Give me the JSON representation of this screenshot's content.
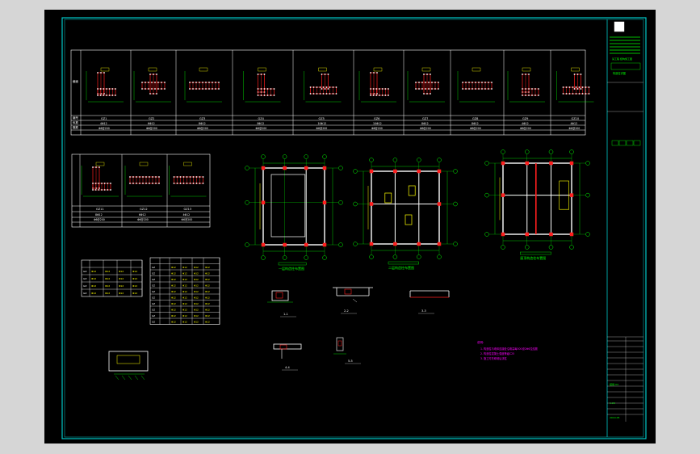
{
  "drawing": {
    "sheet_name": "CAD structural drawing sheet",
    "colors": {
      "background": "#000000",
      "frame": "#00c8c8",
      "lines": "#ffffff",
      "rebar": "#ff1e1e",
      "dims": "#00ff00",
      "text_yellow": "#ffff00",
      "notes": "#ff00ff"
    },
    "title_block": {
      "project": "某工程 结构施工图",
      "drawing_title": "构造柱详图",
      "drawing_no": "结施-04",
      "scale": "1:20",
      "date": "2010.05"
    },
    "column_table_top": {
      "row_labels": [
        "截面",
        "编号",
        "纵筋",
        "箍筋"
      ],
      "columns": [
        {
          "id": "GZ1",
          "bars": "4Φ12",
          "stirrup": "Φ6@200"
        },
        {
          "id": "GZ2",
          "bars": "6Φ12",
          "stirrup": "Φ6@200"
        },
        {
          "id": "GZ3",
          "bars": "8Φ12",
          "stirrup": "Φ6@200"
        },
        {
          "id": "GZ4",
          "bars": "8Φ12",
          "stirrup": "Φ6@200"
        },
        {
          "id": "GZ5",
          "bars": "10Φ12",
          "stirrup": "Φ6@200"
        },
        {
          "id": "GZ6",
          "bars": "10Φ12",
          "stirrup": "Φ6@200"
        },
        {
          "id": "GZ7",
          "bars": "8Φ12",
          "stirrup": "Φ6@200"
        },
        {
          "id": "GZ8",
          "bars": "8Φ12",
          "stirrup": "Φ6@200"
        },
        {
          "id": "GZ9",
          "bars": "4Φ12",
          "stirrup": "Φ6@200"
        },
        {
          "id": "GZ10",
          "bars": "4Φ12",
          "stirrup": "Φ6@200"
        }
      ]
    },
    "column_table_small": {
      "columns": [
        {
          "id": "GZ11",
          "bars": "8Φ12",
          "stirrup": "Φ6@200"
        },
        {
          "id": "GZ12",
          "bars": "6Φ12",
          "stirrup": "Φ6@200"
        },
        {
          "id": "GZ13",
          "bars": "4Φ12",
          "stirrup": "Φ6@200"
        }
      ]
    },
    "plan_titles": [
      "一层构造柱布置图",
      "二层构造柱布置图",
      "屋顶构造柱布置图"
    ],
    "section_labels": [
      "1-1",
      "2-2",
      "3-3",
      "4-4",
      "5-5"
    ],
    "notes_title": "说明:",
    "notes": [
      "1. 构造柱与墙体连接处沿墙高每500设2Φ6拉结筋",
      "2. 构造柱混凝土强度等级C25",
      "3. 施工时先砌墙后浇柱"
    ]
  }
}
